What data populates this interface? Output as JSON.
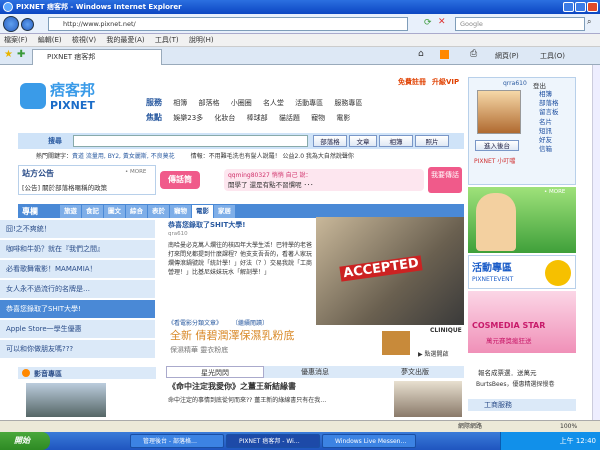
{
  "window": {
    "title": "PIXNET 痞客邦 - Windows Internet Explorer"
  },
  "address": {
    "url": "http://www.pixnet.net/",
    "search_placeholder": "Google"
  },
  "menu": [
    "檔案(F)",
    "編輯(E)",
    "檢視(V)",
    "我的最愛(A)",
    "工具(T)",
    "說明(H)"
  ],
  "browser_tab": {
    "label": "PIXNET 痞客邦"
  },
  "toolbar": {
    "page": "網頁(P)",
    "tools": "工具(O)"
  },
  "site": {
    "logo_cn": "痞客邦",
    "logo_en": "PIXNET",
    "top_links": [
      "免費註冊",
      "升級VIP"
    ],
    "nav_service": "服務",
    "nav_service_items": [
      "相簿",
      "部落格",
      "小圈圈",
      "名人堂",
      "活動專區",
      "服務專區"
    ],
    "nav_focus": "焦點",
    "nav_focus_items": [
      "娛樂23多",
      "化妝台",
      "棒球部",
      "貓話題",
      "寵物",
      "電影"
    ],
    "search_label": "搜尋",
    "search_buttons": [
      "部落格",
      "文章",
      "相簿",
      "照片"
    ],
    "hot_keywords_label": "熱門關鍵字：",
    "hot_keywords": "責道 流量用, BY2, 黃女麗斯, 不良莫花",
    "hot_info": "情報：不用難毛洗也有髮人說羅！ 公益2.0 我為大自然說聲你"
  },
  "user": {
    "name": "qrra610",
    "logout": "登出",
    "enter_backend": "進入後台",
    "small_window": "PIXNET 小叮噹",
    "links": [
      "相簿",
      "部落格",
      "留言板",
      "名片",
      "短訊",
      "好友",
      "信箱"
    ]
  },
  "announce": {
    "title": "站方公告",
    "more": "• MORE",
    "text": "[公告] 關於部落格暱稱的政策"
  },
  "chat": {
    "logo": "傳話筒",
    "message": "qqming80327 悄悄 自己 說：",
    "message2": "開學了 還是有點不習慣呢 ･･･",
    "button": "我要傳話"
  },
  "feature": {
    "title": "專欄",
    "tabs": [
      "旅遊",
      "食記",
      "圖文",
      "綜合",
      "表於",
      "寵物",
      "電影",
      "家居"
    ],
    "selected": "電影",
    "items": [
      "囧!之不爽統！",
      "咖啡和牛奶？就在『我們之間』",
      "必看歌舞電影！MAMAMIA！",
      "女人永不過流行的名牌是…",
      "恭喜您錄取了SHIT大學!",
      "Apple Store一學生優惠",
      "可以和你做朋友嗎???"
    ],
    "selected_item": "恭喜您錄取了SHIT大學!"
  },
  "article": {
    "title": "恭喜您錄取了SHIT大學!",
    "author": "qra610",
    "body": "南哈曼必克萬人爛往的核四年大學生活！巴特學的老爸打來問兒都提到什麼課程？他支支吾吾的，看著人家玩爛傳滾鍋號說「統計學！」好法（？）交易我說「工商營理！」比基尼妹妹玩水「解剖學！」",
    "link": "《看電影分類文章》",
    "more": "〔繼續閱讀〕",
    "image_text": "ACCEPTED"
  },
  "ad": {
    "headline": "全新 倩碧潤澤保濕乳粉底",
    "sub": "保濕精華 靈衣粉底",
    "brand": "CLINIQUE",
    "more": "▶ 點選開啟"
  },
  "bottom_tabs": [
    "星光閃閃",
    "優惠消息",
    "夢文出版"
  ],
  "bottom_article": {
    "title": "《命中注定我愛你》之薑王新結緣書",
    "text": "命中注定的事情到底從何而來?? 薑王新的綠線書只有在我…"
  },
  "video": {
    "title": "影音專區"
  },
  "right": {
    "more": "• MORE",
    "event_title": "活動專區",
    "event_sub": "PIXNETEVENT",
    "cosmedia": "COSMEDIA STAR",
    "cosmedia_sub": "萬元賽獎瘋狂送",
    "promo1": "報名成票選．送萬元",
    "promo2": "BurtsBees，優惠精選探慢卷",
    "shop": "工商服務"
  },
  "status": {
    "zone": "網際網路",
    "zoom": "100%"
  },
  "taskbar": {
    "start": "開始",
    "items": [
      "管理後台 ‑ 部落格…",
      "PIXNET 痞客邦 ‑ Wi…",
      "Windows Live Messen…"
    ],
    "clock": "上午 12:40"
  }
}
